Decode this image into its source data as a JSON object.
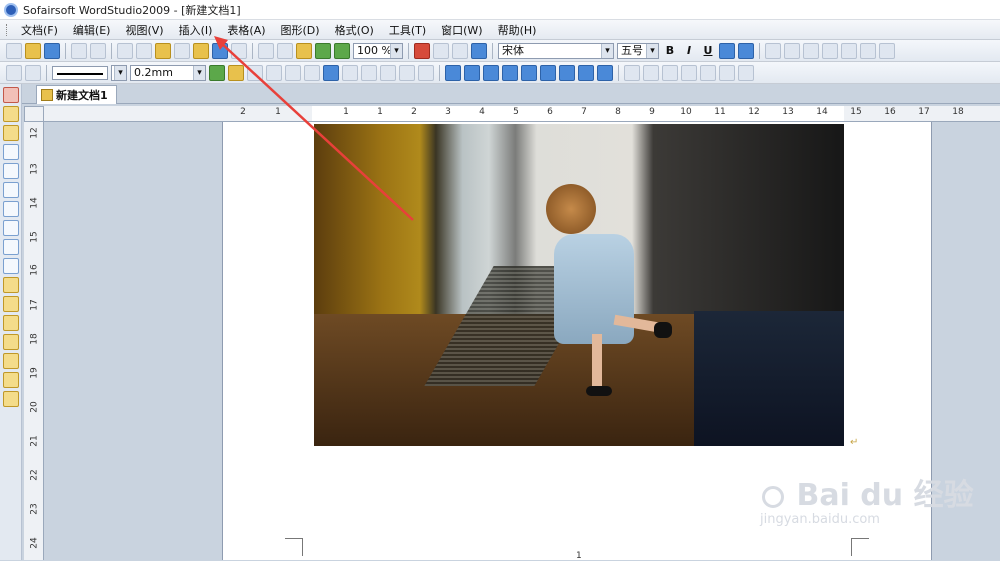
{
  "window": {
    "title": "Sofairsoft WordStudio2009 - [新建文档1]"
  },
  "menu": {
    "items": [
      "文档(F)",
      "编辑(E)",
      "视图(V)",
      "插入(I)",
      "表格(A)",
      "图形(D)",
      "格式(O)",
      "工具(T)",
      "窗口(W)",
      "帮助(H)"
    ]
  },
  "toolbar": {
    "zoom": "100 %",
    "font_name": "宋体",
    "font_size": "五号",
    "bold": "B",
    "italic": "I",
    "underline": "U",
    "line_width": "0.2mm"
  },
  "tab": {
    "label": "新建文档1"
  },
  "ruler": {
    "h_labels": [
      "2",
      "1",
      "1",
      "1",
      "2",
      "3",
      "4",
      "5",
      "6",
      "7",
      "8",
      "9",
      "10",
      "11",
      "12",
      "13",
      "14",
      "15",
      "16",
      "17",
      "18"
    ],
    "v_labels": [
      "12",
      "13",
      "14",
      "15",
      "16",
      "17",
      "18",
      "19",
      "20",
      "21",
      "22",
      "23",
      "24"
    ]
  },
  "page": {
    "number": "1"
  },
  "watermark": {
    "main": "Bai du 经验",
    "sub": "jingyan.baidu.com"
  },
  "colors": {
    "arrow": "#e8403a",
    "accent": "#2d5fb8"
  }
}
